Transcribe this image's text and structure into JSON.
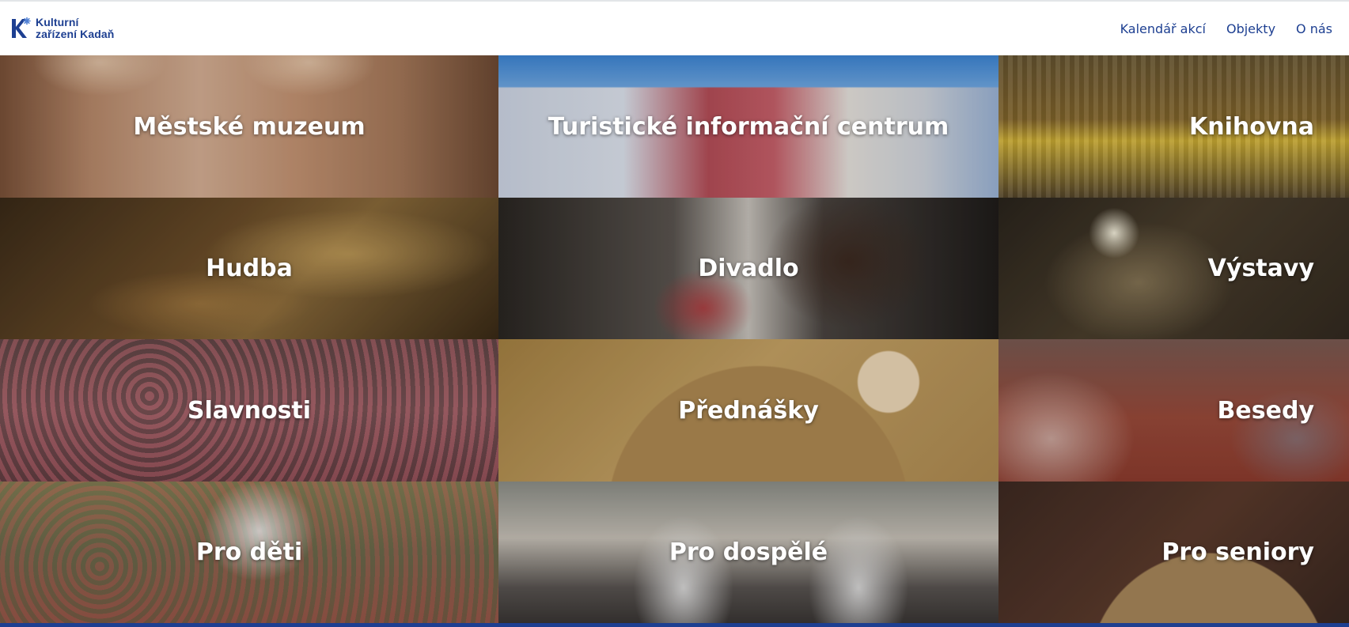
{
  "brand": {
    "line1": "Kulturní",
    "line2": "zařízení Kadaň",
    "colors": {
      "brand_blue": "#1d3f91",
      "accent_star": "#4f7fd3"
    }
  },
  "nav": {
    "items": [
      {
        "label": "Kalendář akcí"
      },
      {
        "label": "Objekty"
      },
      {
        "label": "O nás"
      }
    ]
  },
  "tiles": [
    {
      "label": "Městské muzeum"
    },
    {
      "label": "Turistické informační centrum"
    },
    {
      "label": "Knihovna"
    },
    {
      "label": "Hudba"
    },
    {
      "label": "Divadlo"
    },
    {
      "label": "Výstavy"
    },
    {
      "label": "Slavnosti"
    },
    {
      "label": "Přednášky"
    },
    {
      "label": "Besedy"
    },
    {
      "label": "Pro děti"
    },
    {
      "label": "Pro dospělé"
    },
    {
      "label": "Pro seniory"
    }
  ]
}
